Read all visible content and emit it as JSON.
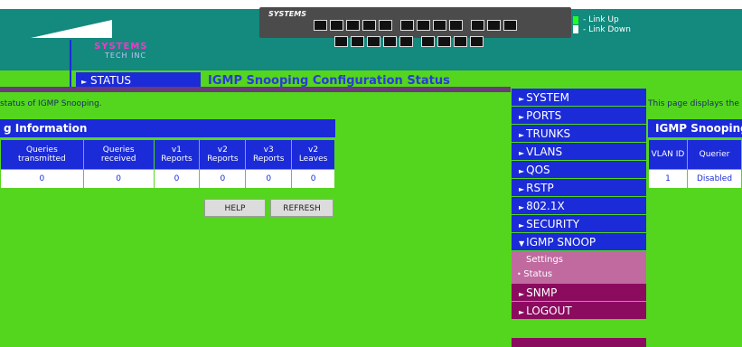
{
  "banner": {
    "switch_brand": "SYSTEMS",
    "brand_name": "SYSTEMS",
    "brand_sub": "TECH INC",
    "legend_up": "- Link Up",
    "legend_down": "- Link Down",
    "ports_row1_count": 12,
    "ports_row2_count": 9
  },
  "header": {
    "status_tab": "STATUS",
    "page_title": "IGMP Snooping Configuration Status"
  },
  "left": {
    "description": "status of IGMP Snooping.",
    "table_title": "g Information",
    "columns": [
      "Queries transmitted",
      "Queries received",
      "v1 Reports",
      "v2 Reports",
      "v3 Reports",
      "v2 Leaves"
    ],
    "rows": [
      [
        "0",
        "0",
        "0",
        "0",
        "0",
        "0"
      ]
    ],
    "help_label": "HELP",
    "refresh_label": "REFRESH"
  },
  "nav": {
    "items": [
      {
        "label": "SYSTEM"
      },
      {
        "label": "PORTS"
      },
      {
        "label": "TRUNKS"
      },
      {
        "label": "VLANS"
      },
      {
        "label": "QOS"
      },
      {
        "label": "RSTP"
      },
      {
        "label": "802.1X"
      },
      {
        "label": "SECURITY"
      },
      {
        "label": "IGMP SNOOP"
      }
    ],
    "sub_items": [
      {
        "label": "Settings"
      },
      {
        "label": "Status"
      }
    ],
    "tail_items": [
      {
        "label": "SNMP"
      },
      {
        "label": "LOGOUT"
      }
    ]
  },
  "right": {
    "description": "This page displays the",
    "table_title": "IGMP Snooping",
    "columns": [
      "VLAN ID",
      "Querier"
    ],
    "rows": [
      [
        "1",
        "Disabled"
      ]
    ]
  },
  "colors": {
    "background": "#55d61e",
    "nav_blue": "#1b2bd8",
    "nav_maroon": "#8b0c5f",
    "sub_panel": "#c06aa0",
    "link_up": "#20ff20"
  }
}
